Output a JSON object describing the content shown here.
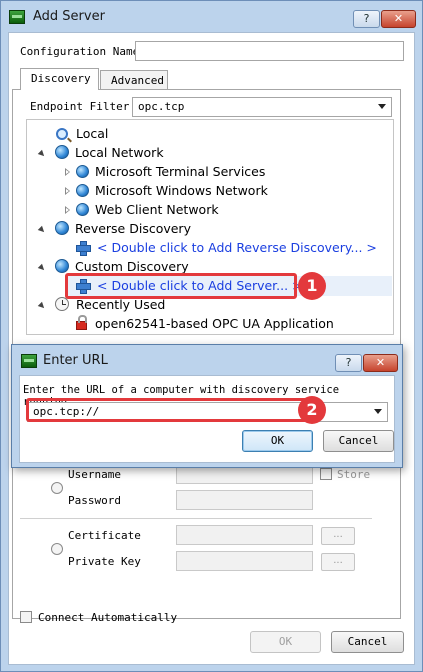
{
  "main_dialog": {
    "title": "Add Server",
    "help_glyph": "?",
    "close_glyph": "✕",
    "config_name_label": "Configuration Name",
    "config_name_value": "",
    "tabs": [
      {
        "label": "Discovery",
        "active": true
      },
      {
        "label": "Advanced",
        "active": false
      }
    ],
    "endpoint_filter_label": "Endpoint Filter:",
    "endpoint_filter_value": "opc.tcp",
    "tree": {
      "local": "Local",
      "local_network": "Local Network",
      "local_network_children": [
        "Microsoft Terminal Services",
        "Microsoft Windows Network",
        "Web Client Network"
      ],
      "reverse_discovery": "Reverse Discovery",
      "reverse_discovery_add": "< Double click to Add Reverse Discovery... >",
      "custom_discovery": "Custom Discovery",
      "custom_discovery_add": "< Double click to Add Server... >",
      "recently_used": "Recently Used",
      "recently_used_children": [
        "open62541-based OPC UA Application"
      ]
    },
    "auth": {
      "username_label": "Username",
      "password_label": "Password",
      "store_label": "Store",
      "certificate_label": "Certificate",
      "private_key_label": "Private Key",
      "browse_label": "..."
    },
    "connect_automatically_label": "Connect Automatically",
    "ok_label": "OK",
    "cancel_label": "Cancel"
  },
  "url_dialog": {
    "title": "Enter URL",
    "help_glyph": "?",
    "close_glyph": "✕",
    "prompt": "Enter the URL of a computer with discovery service running:",
    "url_value": "opc.tcp://",
    "ok_label": "OK",
    "cancel_label": "Cancel"
  },
  "annotations": {
    "badge_1": "1",
    "badge_2": "2",
    "color": "#e3393c"
  }
}
